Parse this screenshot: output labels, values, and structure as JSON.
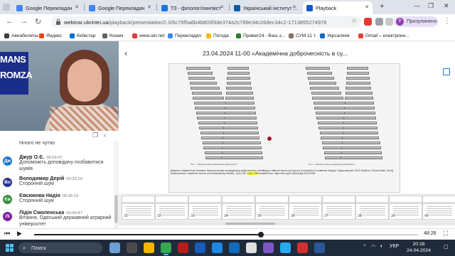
{
  "colors": {
    "accent": "#1a73e8",
    "tabbar_bg": "#dfe3eb",
    "taskbar_bg": "#1f2a3a",
    "highlight": "#ffff33"
  },
  "browser": {
    "tabs": [
      {
        "label": "Google Перекладач",
        "icon": "google-translate-icon",
        "active": false
      },
      {
        "label": "Google Перекладач",
        "icon": "google-translate-icon",
        "active": false
      },
      {
        "label": "ТЗ - філолог/лингвіст",
        "icon": "document-icon",
        "active": false
      },
      {
        "label": "Український інститут ...",
        "icon": "institute-icon",
        "active": false
      },
      {
        "label": "Playback",
        "icon": "playback-icon",
        "active": true
      }
    ],
    "url_host": "webinar.ukrintei.ua",
    "url_path": "/playback/presentation/2.3/6c79f5a6b4b803f3de374a2c789e34c26dec34c2-1713855274976",
    "profile_label": "Призупинено",
    "profile_initial": "Р"
  },
  "bookmarks": [
    {
      "label": "Авиабилеты",
      "icon": "apps-icon"
    },
    {
      "label": "Яндекс",
      "icon": "yandex-icon"
    },
    {
      "label": "Київстар",
      "icon": "kyivstar-icon"
    },
    {
      "label": "Кошик",
      "icon": "cart-icon"
    },
    {
      "label": "www.ukr.net",
      "icon": "ukrnet-icon"
    },
    {
      "label": "Перекладач",
      "icon": "translate-icon"
    },
    {
      "label": "Погода",
      "icon": "weather-icon"
    },
    {
      "label": "Приват24 - Ваш з...",
      "icon": "privat-icon"
    },
    {
      "label": "СУМ 11 т.",
      "icon": "dictionary-icon"
    },
    {
      "label": "Укрсалінія",
      "icon": "ukrsalinia-icon"
    },
    {
      "label": "Gmail – електронн...",
      "icon": "gmail-icon"
    }
  ],
  "video": {
    "banner_line1": "MANS",
    "banner_line2": "ROMZA"
  },
  "chat": {
    "messages": [
      {
        "initials": "",
        "name": "",
        "time": "",
        "text": "Нічого не чутно",
        "color": "#9e9e9e"
      },
      {
        "initials": "Дж",
        "name": "Джур О.Є.",
        "time": "00:33:07",
        "text": "Допоможіть доповідачу позбавитися шумів",
        "color": "#1976d2"
      },
      {
        "initials": "Во",
        "name": "Володимир Дерій",
        "time": "00:33:19",
        "text": "Сторонній шум",
        "color": "#283593"
      },
      {
        "initials": "Єв",
        "name": "Євсюкова Надія",
        "time": "00:39:10",
        "text": "Сторонній шум",
        "color": "#388e3c"
      },
      {
        "initials": "Лі",
        "name": "Лідія Смоленська",
        "time": "00:40:47",
        "text": "Вітання, Одеський державний аграрний університет",
        "color": "#7b1fa2"
      }
    ]
  },
  "slide": {
    "title": "23.04.2024 11-00 «Академічна доброчесність в су...",
    "caption_left": "Рис. 1 – Фактори впливу на академічну доброчесність",
    "caption_right": "Рис. 2 – Фактори впливу на академічну доброчесність",
    "body_before": "Джерело: Adapted from Mahatme Фактори впливу на академічну доброчесність: Identifying of different factors as sources of perception of academic integrity. Оцінка авторів: 2019. Nadirova, Olena Dudek, Serhiy Moskovchenko. Academic Journal of Interdisciplinary Studies, 11(2), 239.",
    "highlight": "11(2), 239",
    "body_after": " Available from: https://doi.org/10.36941/ajis-2022-0053"
  },
  "thumbnails": [
    {
      "num": "31"
    },
    {
      "num": "32"
    },
    {
      "num": "33"
    },
    {
      "num": "34"
    },
    {
      "num": "35"
    },
    {
      "num": "36"
    },
    {
      "num": "37"
    },
    {
      "num": "38"
    },
    {
      "num": "39"
    },
    {
      "num": "40"
    }
  ],
  "player": {
    "progress": 0.59,
    "duration": "48:26"
  },
  "taskbar": {
    "search_placeholder": "Поиск",
    "language": "УКР",
    "time": "20:28",
    "date": "24.04.2024"
  }
}
